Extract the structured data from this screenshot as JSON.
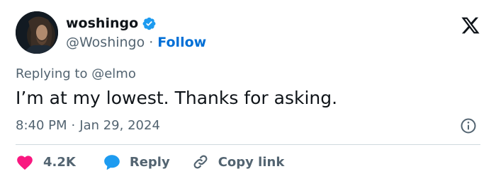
{
  "author": {
    "display_name": "woshingo",
    "handle": "@Woshingo",
    "separator": "·",
    "follow_label": "Follow"
  },
  "reply_context": {
    "prefix": "Replying to",
    "mention": "@elmo"
  },
  "tweet": {
    "text": "I’m at my lowest. Thanks for asking.",
    "time": "8:40 PM",
    "separator": "·",
    "date": "Jan 29, 2024"
  },
  "actions": {
    "like_count": "4.2K",
    "reply_label": "Reply",
    "copy_link_label": "Copy link"
  },
  "icons": {
    "brand": "x-logo-icon",
    "verified": "verified-badge-icon",
    "info": "info-icon",
    "like": "heart-icon",
    "reply": "speech-bubble-icon",
    "copy_link": "link-icon"
  },
  "colors": {
    "text": "#0f1419",
    "muted": "#536471",
    "follow": "#006fd6",
    "verified": "#1d9bf0",
    "heart": "#f91880",
    "reply_bubble": "#1d9bf0",
    "divider": "#cfd9de"
  }
}
